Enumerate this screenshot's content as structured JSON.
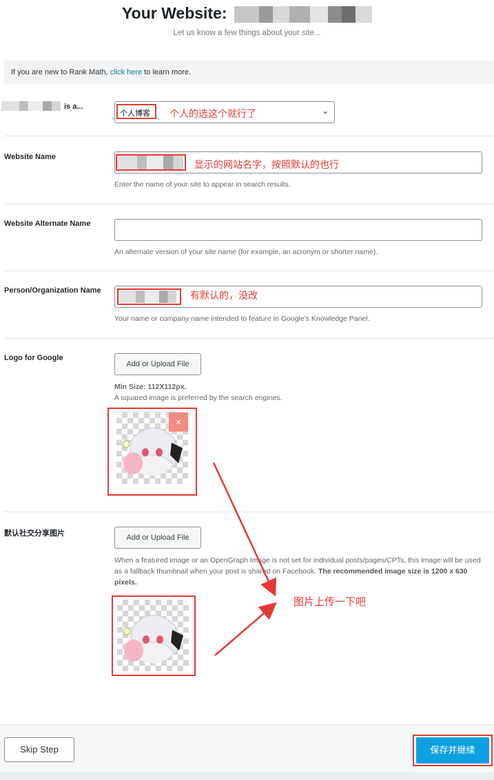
{
  "header": {
    "title": "Your Website:",
    "subtitle": "Let us know a few things about your site..."
  },
  "notice": {
    "prefix": "If you are new to Rank Math,",
    "link": "click here",
    "suffix": "to learn more."
  },
  "site_type": {
    "label_suffix": "is a...",
    "selected": "个人博客",
    "annotation": "个人的选这个就行了"
  },
  "website_name": {
    "label": "Website Name",
    "annotation": "显示的网站名字，按照默认的也行",
    "description": "Enter the name of your site to appear in search results."
  },
  "alternate_name": {
    "label": "Website Alternate Name",
    "value": "",
    "description": "An alternate version of your site name (for example, an acronym or shorter name)."
  },
  "person_org": {
    "label": "Person/Organization Name",
    "annotation": "有默认的，没改",
    "description": "Your name or company name intended to feature in Google's Knowledge Panel."
  },
  "logo": {
    "label": "Logo for Google",
    "button": "Add or Upload File",
    "min_size": "Min Size: 112X112px.",
    "hint": "A squared image is preferred by the search engines.",
    "delete_symbol": "×"
  },
  "social": {
    "label": "默认社交分享图片",
    "button": "Add or Upload File",
    "description_1": "When a featured image or an OpenGraph Image is not set for individual posts/pages/CPTs, this image will be used as a fallback thumbnail when your post is shared on Facebook.",
    "description_bold": "The recommended image size is 1200 x 630 pixels."
  },
  "arrow_note": "图片上传一下吧",
  "footer": {
    "skip": "Skip Step",
    "save": "保存并继续"
  },
  "colors": {
    "accent": "#0ea0e0",
    "annotation_red": "#e53935",
    "link": "#2271b1"
  }
}
